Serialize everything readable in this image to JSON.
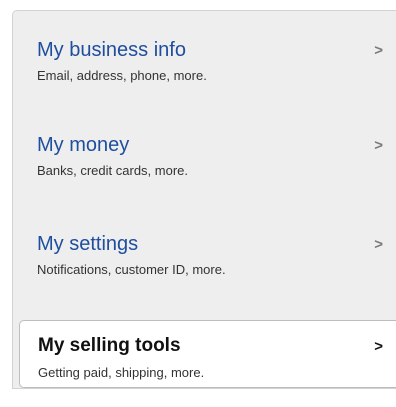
{
  "nav": {
    "items": [
      {
        "title": "My business info",
        "subtitle": "Email, address, phone, more.",
        "chevron": ">"
      },
      {
        "title": "My money",
        "subtitle": "Banks, credit cards, more.",
        "chevron": ">"
      },
      {
        "title": "My settings",
        "subtitle": "Notifications, customer ID, more.",
        "chevron": ">"
      },
      {
        "title": "My selling tools",
        "subtitle": "Getting paid, shipping, more.",
        "chevron": ">",
        "active": true
      }
    ]
  },
  "colors": {
    "link": "#1f4e9e",
    "panel_bg": "#eeeeee",
    "active_bg": "#ffffff"
  }
}
